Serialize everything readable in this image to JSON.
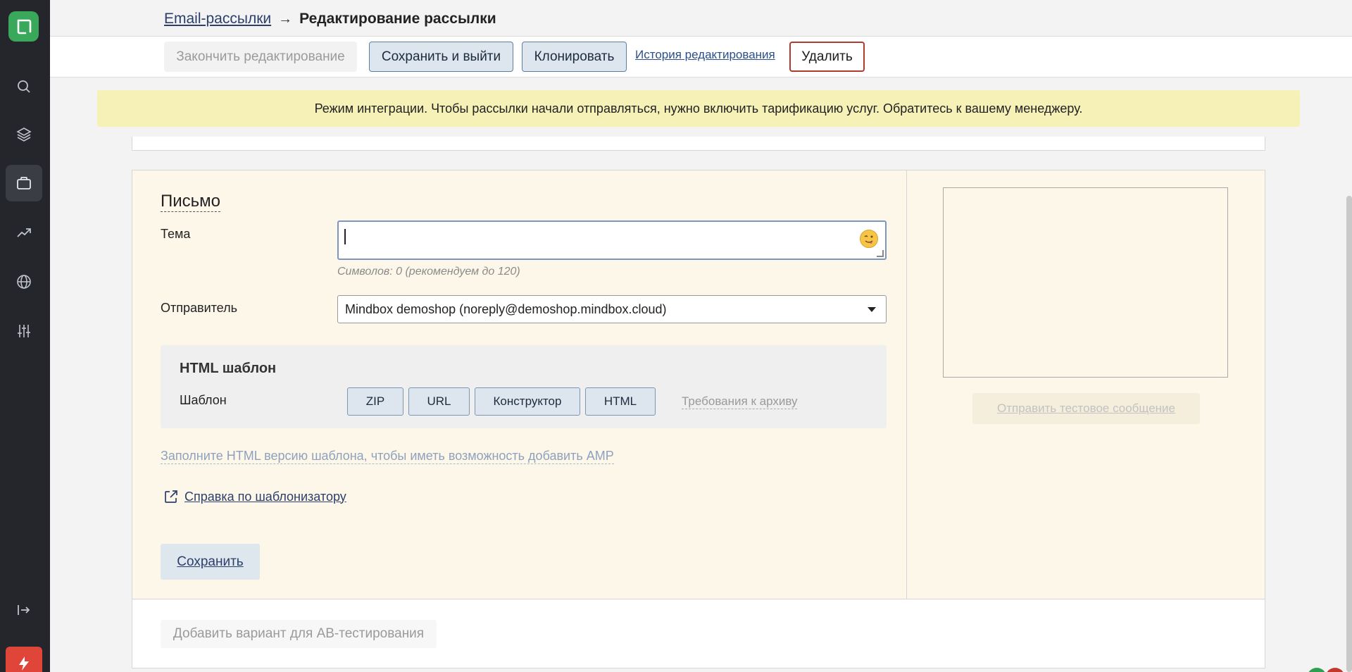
{
  "breadcrumb": {
    "parent": "Email-рассылки",
    "arrow": "→",
    "current": "Редактирование рассылки"
  },
  "toolbar": {
    "finish": "Закончить редактирование",
    "save_exit": "Сохранить и выйти",
    "clone": "Клонировать",
    "history": "История редактирования",
    "delete": "Удалить"
  },
  "notice": "Режим интеграции. Чтобы рассылки начали отправляться, нужно включить тарификацию услуг. Обратитесь к вашему менеджеру.",
  "letter": {
    "title": "Письмо",
    "subject_label": "Тема",
    "subject_value": "",
    "subject_hint": "Символов: 0 (рекомендуем до 120)",
    "sender_label": "Отправитель",
    "sender_value": "Mindbox demoshop (noreply@demoshop.mindbox.cloud)",
    "html_template": {
      "title": "HTML шаблон",
      "label": "Шаблон",
      "options": [
        "ZIP",
        "URL",
        "Конструктор",
        "HTML"
      ],
      "requirements": "Требования к архиву"
    },
    "amp_link": "Заполните HTML версию шаблона, чтобы иметь возможность добавить AMP",
    "help_link": "Справка по шаблонизатору",
    "save": "Сохранить"
  },
  "preview": {
    "send_test": "Отправить тестовое сообщение"
  },
  "ab_test": "Добавить вариант для AB-тестирования",
  "colors": {
    "sidebar": "#24262b",
    "brand_logo": "#3aa85a",
    "notice_bg": "#f6f1b7",
    "panel_bg": "#fdf7ea",
    "delete_border": "#b13a2f"
  },
  "sidebar_icons": [
    "search-icon",
    "layers-icon",
    "briefcase-icon",
    "trending-icon",
    "globe-icon",
    "sliders-icon",
    "expand-icon",
    "bolt-icon"
  ]
}
